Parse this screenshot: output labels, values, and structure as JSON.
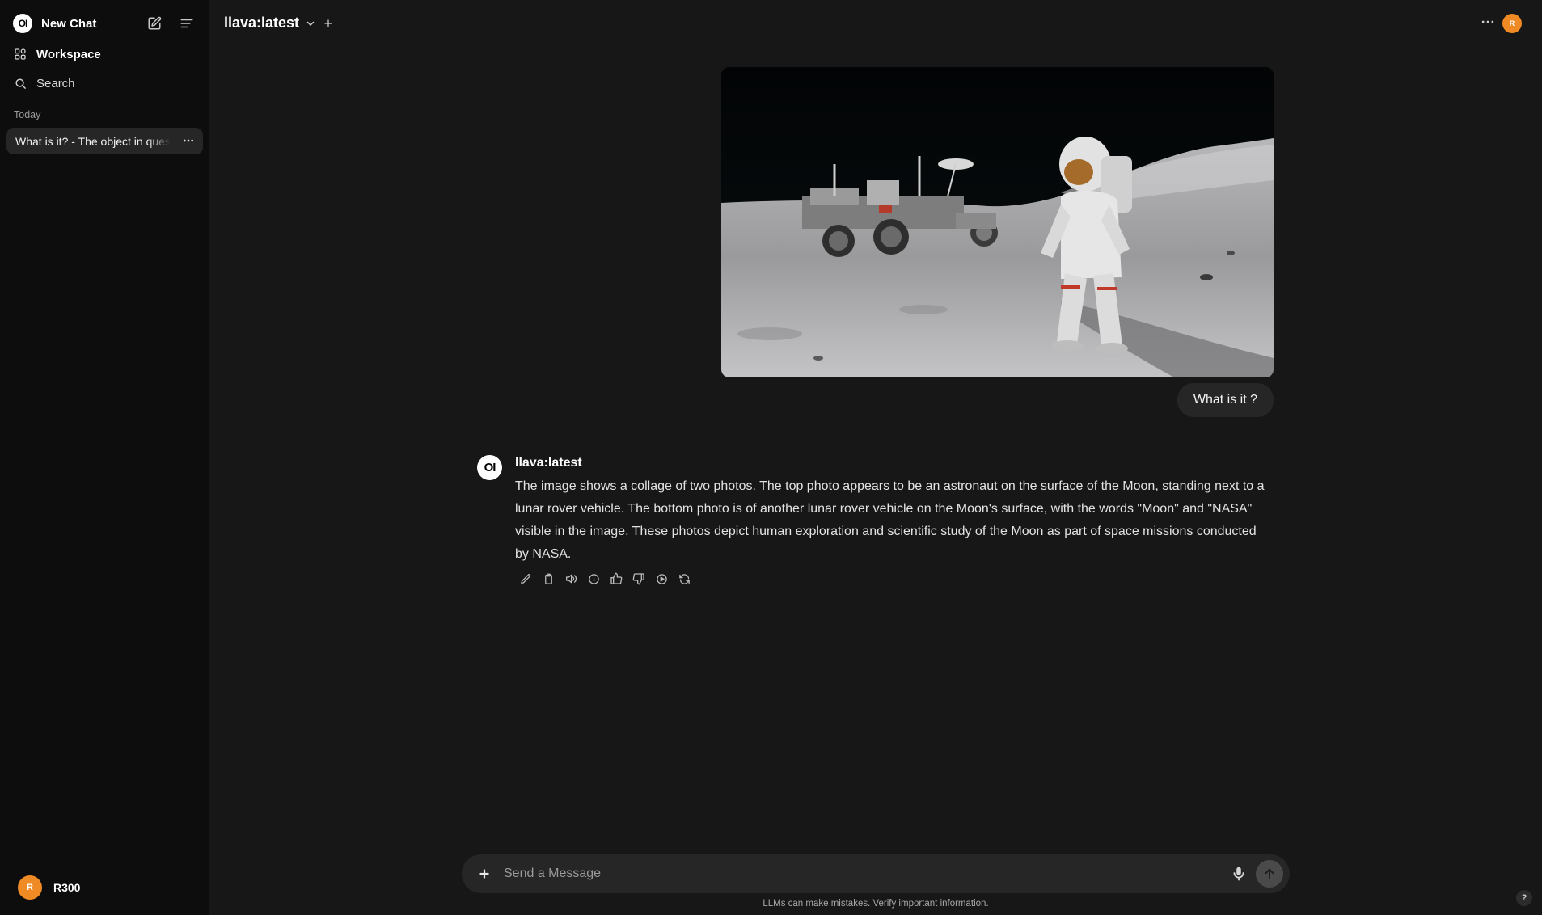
{
  "sidebar": {
    "logo_text": "OI",
    "new_chat_label": "New Chat",
    "workspace_label": "Workspace",
    "search_label": "Search",
    "section_today": "Today",
    "chat_items": [
      {
        "title": "What is it? - The object in question"
      }
    ],
    "user": {
      "initial": "R",
      "name": "R300"
    }
  },
  "header": {
    "model_name": "llava:latest",
    "avatar_initial": "R"
  },
  "conversation": {
    "user_message": "What is it ?",
    "assistant": {
      "logo_text": "OI",
      "name": "llava:latest",
      "text": "The image shows a collage of two photos. The top photo appears to be an astronaut on the surface of the Moon, standing next to a lunar rover vehicle. The bottom photo is of another lunar rover vehicle on the Moon's surface, with the words \"Moon\" and \"NASA\" visible in the image. These photos depict human exploration and scientific study of the Moon as part of space missions conducted by NASA.",
      "actions": [
        "edit-icon",
        "copy-icon",
        "speaker-icon",
        "info-icon",
        "thumbs-up-icon",
        "thumbs-down-icon",
        "play-icon",
        "regenerate-icon"
      ]
    }
  },
  "composer": {
    "placeholder": "Send a Message",
    "value": ""
  },
  "footer": {
    "disclaimer": "LLMs can make mistakes. Verify important information.",
    "help_label": "?"
  },
  "colors": {
    "background": "#171717",
    "sidebar": "#0d0d0d",
    "bubble": "#262626",
    "avatar": "#f08a24"
  }
}
